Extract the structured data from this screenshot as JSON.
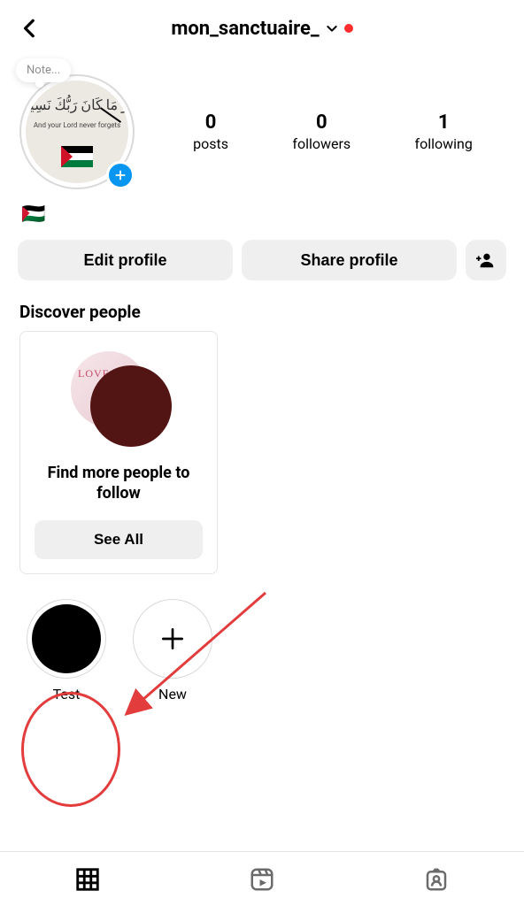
{
  "header": {
    "username": "mon_sanctuaire_",
    "has_notification": true
  },
  "avatar": {
    "note_label": "Note...",
    "arabic_text": "وَ مَا كَانَ رَبُّكَ نَسِيًّا",
    "english_text": "And your Lord never forgets"
  },
  "stats": {
    "posts_value": "0",
    "posts_label": "posts",
    "followers_value": "0",
    "followers_label": "followers",
    "following_value": "1",
    "following_label": "following"
  },
  "bio": {
    "text": "🇵🇸"
  },
  "actions": {
    "edit_profile": "Edit profile",
    "share_profile": "Share profile"
  },
  "discover": {
    "title": "Discover people",
    "card_text": "Find more people to follow",
    "love_text": "LOVE",
    "see_all": "See All"
  },
  "highlights": {
    "items": [
      {
        "label": "Test"
      },
      {
        "label": "New"
      }
    ]
  }
}
